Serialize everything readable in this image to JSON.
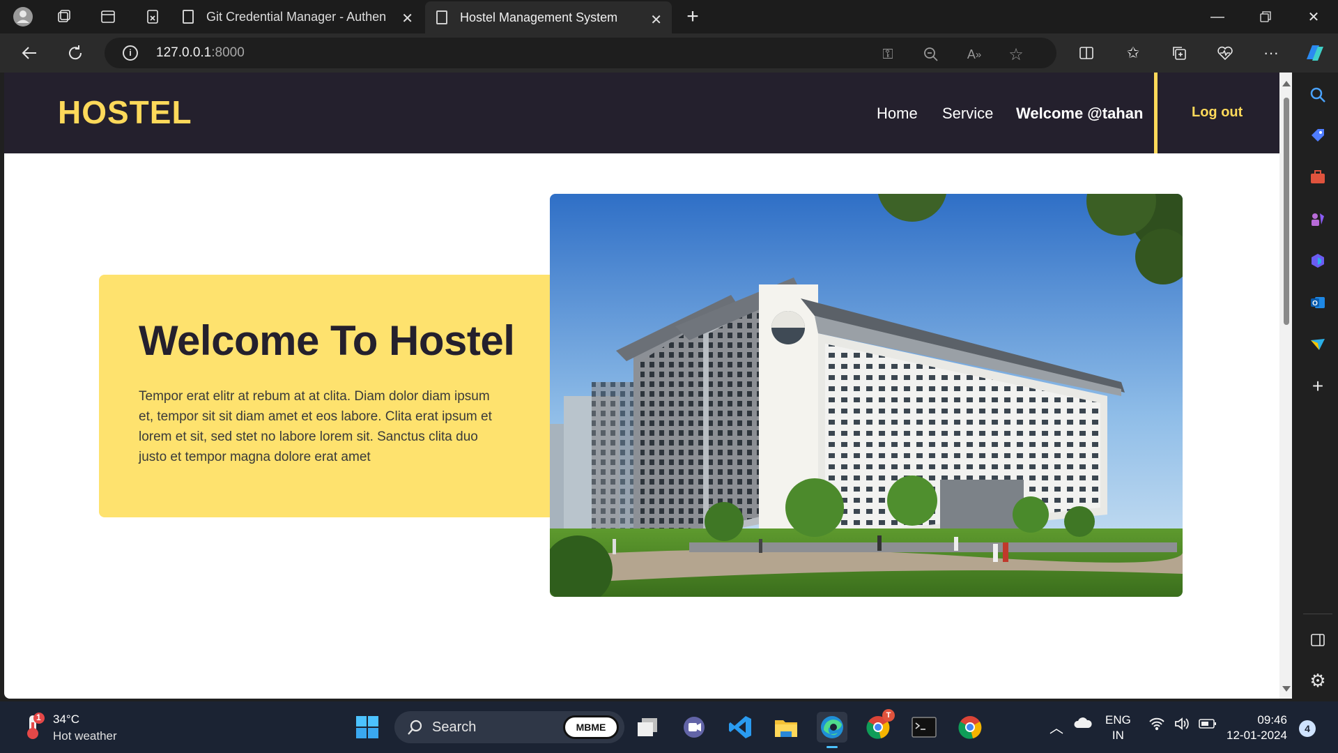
{
  "browser": {
    "tabs": [
      {
        "title": "Git Credential Manager - Authen",
        "active": false
      },
      {
        "title": "Hostel Management System",
        "active": true
      }
    ],
    "url_host": "127.0.0.1",
    "url_port": ":8000"
  },
  "site": {
    "brand": "HOSTEL",
    "nav": {
      "home": "Home",
      "service": "Service",
      "welcome": "Welcome @tahan",
      "logout": "Log out"
    },
    "hero": {
      "title": "Welcome To Hostel",
      "text": "Tempor erat elitr at rebum at at clita. Diam dolor diam ipsum et, tempor sit sit diam amet et eos labore. Clita erat ipsum et lorem et sit, sed stet no labore lorem sit. Sanctus clita duo justo et tempor magna dolore erat amet"
    },
    "colors": {
      "header_bg": "#24202d",
      "accent": "#fdd95a",
      "card_bg": "#fee26e"
    }
  },
  "taskbar": {
    "weather": {
      "temp": "34°C",
      "desc": "Hot weather",
      "badge": "1"
    },
    "search_label": "Search",
    "mbme_label": "MBME",
    "chrome_badge": "T",
    "language": {
      "line1": "ENG",
      "line2": "IN"
    },
    "time": "09:46",
    "date": "12-01-2024",
    "notifications": "4"
  }
}
